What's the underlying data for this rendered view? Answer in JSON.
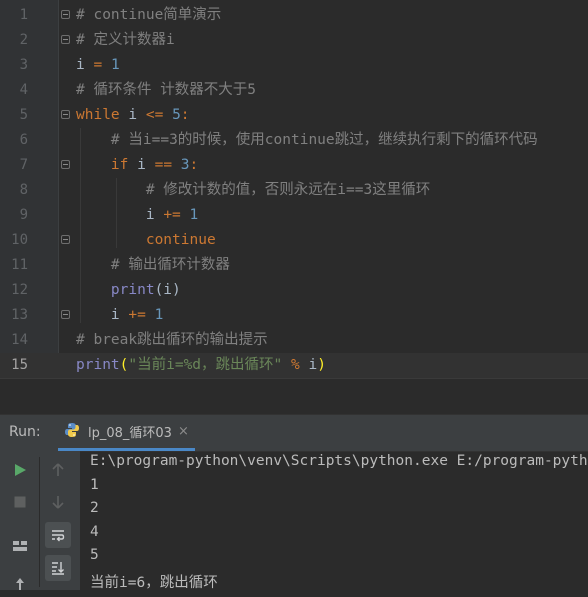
{
  "editor": {
    "current_line": 15,
    "lines": [
      {
        "n": "1",
        "tokens": [
          {
            "t": "# continue简单演示",
            "c": "cm"
          }
        ]
      },
      {
        "n": "2",
        "tokens": [
          {
            "t": "# 定义计数器i",
            "c": "cm"
          }
        ]
      },
      {
        "n": "3",
        "tokens": [
          {
            "t": "i",
            "c": "var"
          },
          {
            "t": " = ",
            "c": "op"
          },
          {
            "t": "1",
            "c": "num"
          }
        ]
      },
      {
        "n": "4",
        "tokens": [
          {
            "t": "# 循环条件 计数器不大于5",
            "c": "cm"
          }
        ]
      },
      {
        "n": "5",
        "tokens": [
          {
            "t": "while",
            "c": "kw"
          },
          {
            "t": " i ",
            "c": "var"
          },
          {
            "t": "<=",
            "c": "op"
          },
          {
            "t": " ",
            "c": "var"
          },
          {
            "t": "5",
            "c": "num"
          },
          {
            "t": ":",
            "c": "op"
          }
        ]
      },
      {
        "n": "6",
        "tokens": [
          {
            "t": "    # 当i==3的时候，使用continue跳过，继续执行剩下的循环代码",
            "c": "cm"
          }
        ]
      },
      {
        "n": "7",
        "tokens": [
          {
            "t": "    ",
            "c": "var"
          },
          {
            "t": "if",
            "c": "kw"
          },
          {
            "t": " i ",
            "c": "var"
          },
          {
            "t": "==",
            "c": "op"
          },
          {
            "t": " ",
            "c": "var"
          },
          {
            "t": "3",
            "c": "num"
          },
          {
            "t": ":",
            "c": "op"
          }
        ]
      },
      {
        "n": "8",
        "tokens": [
          {
            "t": "        # 修改计数的值，否则永远在i==3这里循环",
            "c": "cm"
          }
        ]
      },
      {
        "n": "9",
        "tokens": [
          {
            "t": "        i ",
            "c": "var"
          },
          {
            "t": "+=",
            "c": "op"
          },
          {
            "t": " ",
            "c": "var"
          },
          {
            "t": "1",
            "c": "num"
          }
        ]
      },
      {
        "n": "10",
        "tokens": [
          {
            "t": "        ",
            "c": "var"
          },
          {
            "t": "continue",
            "c": "kw"
          }
        ]
      },
      {
        "n": "11",
        "tokens": [
          {
            "t": "    # 输出循环计数器",
            "c": "cm"
          }
        ]
      },
      {
        "n": "12",
        "tokens": [
          {
            "t": "    ",
            "c": "var"
          },
          {
            "t": "print",
            "c": "fn"
          },
          {
            "t": "(i)",
            "c": "var"
          }
        ]
      },
      {
        "n": "13",
        "tokens": [
          {
            "t": "    i ",
            "c": "var"
          },
          {
            "t": "+=",
            "c": "op"
          },
          {
            "t": " ",
            "c": "var"
          },
          {
            "t": "1",
            "c": "num"
          }
        ]
      },
      {
        "n": "14",
        "tokens": [
          {
            "t": "# break跳出循环的输出提示",
            "c": "cm"
          }
        ]
      },
      {
        "n": "15",
        "tokens": [
          {
            "t": "print",
            "c": "fn"
          },
          {
            "t": "(",
            "c": "brace"
          },
          {
            "t": "\"当前i=%d，跳出循环\"",
            "c": "str"
          },
          {
            "t": " % ",
            "c": "pct"
          },
          {
            "t": "i",
            "c": "var"
          },
          {
            "t": ")",
            "c": "brace"
          }
        ]
      }
    ]
  },
  "run": {
    "label": "Run:",
    "tab_name": "lp_08_循环03",
    "close_label": "×",
    "output": [
      "E:\\program-python\\venv\\Scripts\\python.exe E:/program-python",
      "1",
      "2",
      "4",
      "5",
      "当前i=6，跳出循环"
    ]
  },
  "colors": {
    "keyword": "#cc7832",
    "comment": "#808080",
    "number": "#6897bb",
    "string": "#6a8759",
    "builtin": "#8888c6",
    "run_green": "#59a869"
  },
  "icons": {
    "python_file": "python-icon",
    "run": "play-icon",
    "stop": "stop-icon",
    "rerun_up": "arrow-up-icon",
    "rerun_down": "arrow-down-icon",
    "layout": "layout-icon",
    "soft_wrap": "soft-wrap-icon",
    "scroll_end": "scroll-to-end-icon",
    "pin": "pin-icon"
  }
}
